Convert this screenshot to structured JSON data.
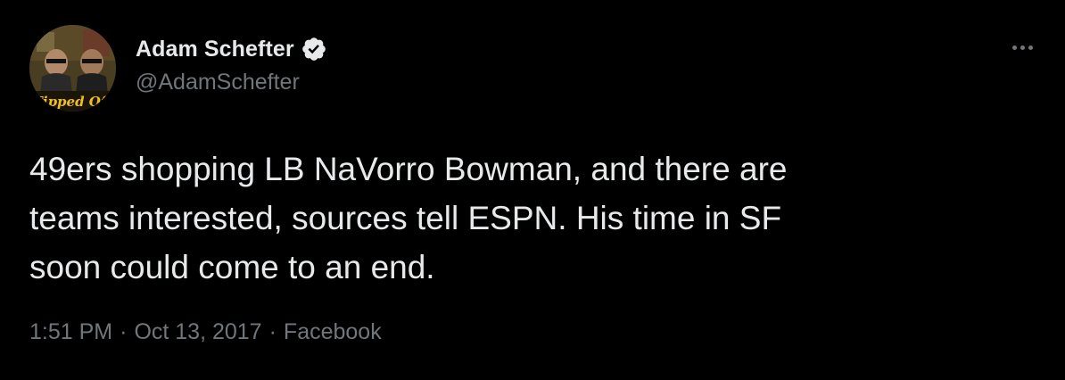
{
  "author": {
    "name": "Adam Schefter",
    "handle": "@AdamSchefter",
    "verified": true,
    "avatar_icon": "profile-photo",
    "avatar_text": "Tipped Off"
  },
  "tweet": {
    "lines": [
      "49ers shopping LB NaVorro Bowman, and there are",
      "teams interested, sources tell ESPN. His time in SF",
      "soon could come to an end."
    ],
    "time": "1:51 PM",
    "date": "Oct 13, 2017",
    "source": "Facebook",
    "separator": "·"
  },
  "colors": {
    "background": "#000000",
    "text": "#e7e9ea",
    "muted": "#71767b",
    "verified_badge": "#e7e9ea"
  },
  "icons": {
    "more": "more-horizontal-icon",
    "verified": "verified-badge-icon"
  }
}
